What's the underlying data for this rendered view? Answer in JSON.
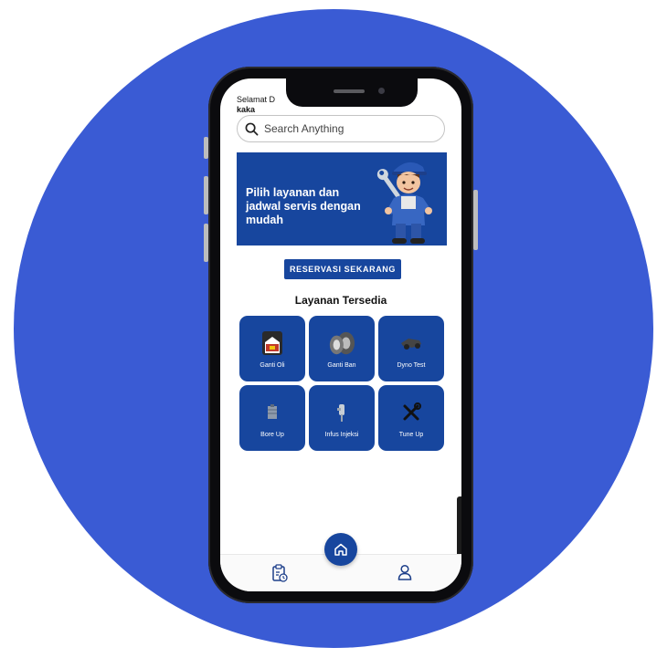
{
  "greeting": {
    "line1": "Selamat D",
    "user_name": "kaka"
  },
  "search": {
    "placeholder": "Search Anything"
  },
  "banner": {
    "text": "Pilih layanan dan jadwal servis dengan mudah"
  },
  "cta": {
    "label": "RESERVASI SEKARANG"
  },
  "services": {
    "title": "Layanan Tersedia",
    "items": [
      {
        "label": "Ganti Oli",
        "icon": "oil-change-icon"
      },
      {
        "label": "Ganti Ban",
        "icon": "tire-icon"
      },
      {
        "label": "Dyno Test",
        "icon": "dyno-test-icon"
      },
      {
        "label": "Bore Up",
        "icon": "bore-up-icon"
      },
      {
        "label": "Infus Injeksi",
        "icon": "injection-icon"
      },
      {
        "label": "Tune Up",
        "icon": "tune-up-icon"
      }
    ]
  },
  "bottom_nav": {
    "items": [
      {
        "icon": "clipboard-history-icon"
      },
      {
        "icon": "home-icon",
        "active": true
      },
      {
        "icon": "profile-icon"
      }
    ]
  },
  "colors": {
    "background_circle": "#3a5bd4",
    "primary": "#17469e",
    "phone_frame": "#0b0b0e"
  }
}
